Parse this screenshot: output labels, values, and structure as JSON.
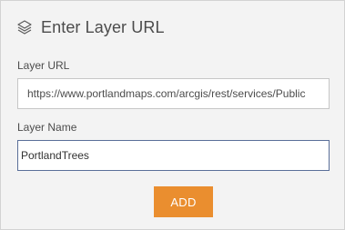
{
  "header": {
    "icon": "layers-icon",
    "title": "Enter Layer URL"
  },
  "form": {
    "layer_url": {
      "label": "Layer URL",
      "value": "https://www.portlandmaps.com/arcgis/rest/services/Public"
    },
    "layer_name": {
      "label": "Layer Name",
      "value": "PortlandTrees"
    },
    "add_label": "ADD"
  },
  "colors": {
    "panel_background": "#f3f3f3",
    "accent_button": "#ea8e2f",
    "focused_border": "#5a6f99",
    "text": "#4c4c4c"
  }
}
